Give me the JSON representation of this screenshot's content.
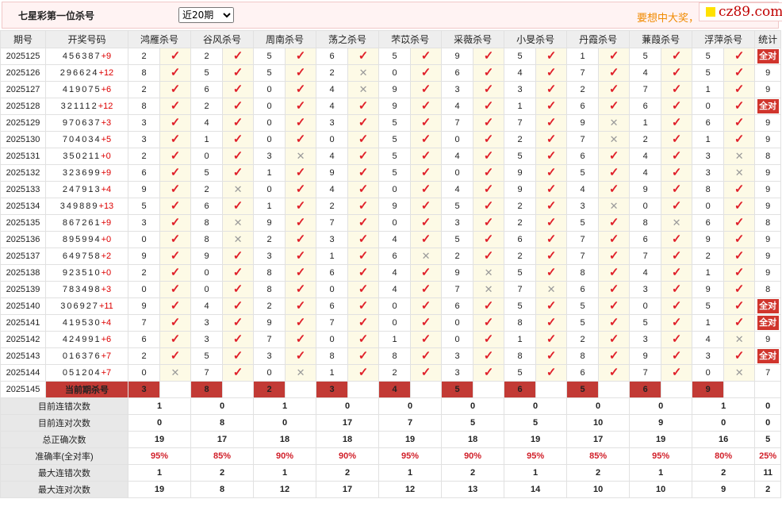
{
  "title": "七星彩第一位杀号",
  "period_select": {
    "selected": "近20期",
    "options": [
      "近20期"
    ]
  },
  "promo_text": "要想中大奖，",
  "logo_text": "cz89.com",
  "headers": {
    "issue": "期号",
    "draw": "开奖号码",
    "stat": "统计"
  },
  "experts": [
    "鸿雁杀号",
    "谷风杀号",
    "周南杀号",
    "荡之杀号",
    "芣苡杀号",
    "采薇杀号",
    "小旻杀号",
    "丹霞杀号",
    "蒹葭杀号",
    "浮萍杀号"
  ],
  "quan_label": "全对",
  "rows": [
    {
      "issue": "2025125",
      "nums": "456387",
      "sum": "+9",
      "kills": [
        "2",
        "2",
        "5",
        "6",
        "5",
        "9",
        "5",
        "1",
        "5",
        "5"
      ],
      "ok": [
        1,
        1,
        1,
        1,
        1,
        1,
        1,
        1,
        1,
        1
      ],
      "stat": "全对"
    },
    {
      "issue": "2025126",
      "nums": "296624",
      "sum": "+12",
      "kills": [
        "8",
        "5",
        "5",
        "2",
        "0",
        "6",
        "4",
        "7",
        "4",
        "5"
      ],
      "ok": [
        1,
        1,
        1,
        0,
        1,
        1,
        1,
        1,
        1,
        1
      ],
      "stat": "9"
    },
    {
      "issue": "2025127",
      "nums": "419075",
      "sum": "+6",
      "kills": [
        "2",
        "6",
        "0",
        "4",
        "9",
        "3",
        "3",
        "2",
        "7",
        "1"
      ],
      "ok": [
        1,
        1,
        1,
        0,
        1,
        1,
        1,
        1,
        1,
        1
      ],
      "stat": "9"
    },
    {
      "issue": "2025128",
      "nums": "321112",
      "sum": "+12",
      "kills": [
        "8",
        "2",
        "0",
        "4",
        "9",
        "4",
        "1",
        "6",
        "6",
        "0"
      ],
      "ok": [
        1,
        1,
        1,
        1,
        1,
        1,
        1,
        1,
        1,
        1
      ],
      "stat": "全对"
    },
    {
      "issue": "2025129",
      "nums": "970637",
      "sum": "+3",
      "kills": [
        "3",
        "4",
        "0",
        "3",
        "5",
        "7",
        "7",
        "9",
        "1",
        "6"
      ],
      "ok": [
        1,
        1,
        1,
        1,
        1,
        1,
        1,
        0,
        1,
        1
      ],
      "stat": "9"
    },
    {
      "issue": "2025130",
      "nums": "704034",
      "sum": "+5",
      "kills": [
        "3",
        "1",
        "0",
        "0",
        "5",
        "0",
        "2",
        "7",
        "2",
        "1"
      ],
      "ok": [
        1,
        1,
        1,
        1,
        1,
        1,
        1,
        0,
        1,
        1
      ],
      "stat": "9"
    },
    {
      "issue": "2025131",
      "nums": "350211",
      "sum": "+0",
      "kills": [
        "2",
        "0",
        "3",
        "4",
        "5",
        "4",
        "5",
        "6",
        "4",
        "3"
      ],
      "ok": [
        1,
        1,
        0,
        1,
        1,
        1,
        1,
        1,
        1,
        0
      ],
      "stat": "8"
    },
    {
      "issue": "2025132",
      "nums": "323699",
      "sum": "+9",
      "kills": [
        "6",
        "5",
        "1",
        "9",
        "5",
        "0",
        "9",
        "5",
        "4",
        "3"
      ],
      "ok": [
        1,
        1,
        1,
        1,
        1,
        1,
        1,
        1,
        1,
        0
      ],
      "stat": "9"
    },
    {
      "issue": "2025133",
      "nums": "247913",
      "sum": "+4",
      "kills": [
        "9",
        "2",
        "0",
        "4",
        "0",
        "4",
        "9",
        "4",
        "9",
        "8"
      ],
      "ok": [
        1,
        0,
        1,
        1,
        1,
        1,
        1,
        1,
        1,
        1
      ],
      "stat": "9"
    },
    {
      "issue": "2025134",
      "nums": "349889",
      "sum": "+13",
      "kills": [
        "5",
        "6",
        "1",
        "2",
        "9",
        "5",
        "2",
        "3",
        "0",
        "0"
      ],
      "ok": [
        1,
        1,
        1,
        1,
        1,
        1,
        1,
        0,
        1,
        1
      ],
      "stat": "9"
    },
    {
      "issue": "2025135",
      "nums": "867261",
      "sum": "+9",
      "kills": [
        "3",
        "8",
        "9",
        "7",
        "0",
        "3",
        "2",
        "5",
        "8",
        "6"
      ],
      "ok": [
        1,
        0,
        1,
        1,
        1,
        1,
        1,
        1,
        0,
        1
      ],
      "stat": "8"
    },
    {
      "issue": "2025136",
      "nums": "895994",
      "sum": "+0",
      "kills": [
        "0",
        "8",
        "2",
        "3",
        "4",
        "5",
        "6",
        "7",
        "6",
        "9"
      ],
      "ok": [
        1,
        0,
        1,
        1,
        1,
        1,
        1,
        1,
        1,
        1
      ],
      "stat": "9"
    },
    {
      "issue": "2025137",
      "nums": "649758",
      "sum": "+2",
      "kills": [
        "9",
        "9",
        "3",
        "1",
        "6",
        "2",
        "2",
        "7",
        "7",
        "2"
      ],
      "ok": [
        1,
        1,
        1,
        1,
        0,
        1,
        1,
        1,
        1,
        1
      ],
      "stat": "9"
    },
    {
      "issue": "2025138",
      "nums": "923510",
      "sum": "+0",
      "kills": [
        "2",
        "0",
        "8",
        "6",
        "4",
        "9",
        "5",
        "8",
        "4",
        "1"
      ],
      "ok": [
        1,
        1,
        1,
        1,
        1,
        0,
        1,
        1,
        1,
        1
      ],
      "stat": "9"
    },
    {
      "issue": "2025139",
      "nums": "783498",
      "sum": "+3",
      "kills": [
        "0",
        "0",
        "8",
        "0",
        "4",
        "7",
        "7",
        "6",
        "3",
        "9"
      ],
      "ok": [
        1,
        1,
        1,
        1,
        1,
        0,
        0,
        1,
        1,
        1
      ],
      "stat": "8"
    },
    {
      "issue": "2025140",
      "nums": "306927",
      "sum": "+11",
      "kills": [
        "9",
        "4",
        "2",
        "6",
        "0",
        "6",
        "5",
        "5",
        "0",
        "5"
      ],
      "ok": [
        1,
        1,
        1,
        1,
        1,
        1,
        1,
        1,
        1,
        1
      ],
      "stat": "全对"
    },
    {
      "issue": "2025141",
      "nums": "419530",
      "sum": "+4",
      "kills": [
        "7",
        "3",
        "9",
        "7",
        "0",
        "0",
        "8",
        "5",
        "5",
        "1"
      ],
      "ok": [
        1,
        1,
        1,
        1,
        1,
        1,
        1,
        1,
        1,
        1
      ],
      "stat": "全对"
    },
    {
      "issue": "2025142",
      "nums": "424991",
      "sum": "+6",
      "kills": [
        "6",
        "3",
        "7",
        "0",
        "1",
        "0",
        "1",
        "2",
        "3",
        "4"
      ],
      "ok": [
        1,
        1,
        1,
        1,
        1,
        1,
        1,
        1,
        1,
        0
      ],
      "stat": "9"
    },
    {
      "issue": "2025143",
      "nums": "016376",
      "sum": "+7",
      "kills": [
        "2",
        "5",
        "3",
        "8",
        "8",
        "3",
        "8",
        "8",
        "9",
        "3"
      ],
      "ok": [
        1,
        1,
        1,
        1,
        1,
        1,
        1,
        1,
        1,
        1
      ],
      "stat": "全对"
    },
    {
      "issue": "2025144",
      "nums": "051204",
      "sum": "+7",
      "kills": [
        "0",
        "7",
        "0",
        "1",
        "2",
        "3",
        "5",
        "6",
        "7",
        "0"
      ],
      "ok": [
        0,
        1,
        0,
        1,
        1,
        1,
        1,
        1,
        1,
        0
      ],
      "stat": "7"
    }
  ],
  "current": {
    "issue": "2025145",
    "label": "当前期杀号",
    "kills": [
      "3",
      "8",
      "2",
      "3",
      "4",
      "5",
      "6",
      "5",
      "6",
      "9"
    ]
  },
  "stats": [
    {
      "label": "目前连错次数",
      "values": [
        "1",
        "0",
        "1",
        "0",
        "0",
        "0",
        "0",
        "0",
        "0",
        "1",
        "0"
      ],
      "red": false
    },
    {
      "label": "目前连对次数",
      "values": [
        "0",
        "8",
        "0",
        "17",
        "7",
        "5",
        "5",
        "10",
        "9",
        "0",
        "0"
      ],
      "red": false
    },
    {
      "label": "总正确次数",
      "values": [
        "19",
        "17",
        "18",
        "18",
        "19",
        "18",
        "19",
        "17",
        "19",
        "16",
        "5"
      ],
      "red": false
    },
    {
      "label": "准确率(全对率)",
      "values": [
        "95%",
        "85%",
        "90%",
        "90%",
        "95%",
        "90%",
        "95%",
        "85%",
        "95%",
        "80%",
        "25%"
      ],
      "red": true
    },
    {
      "label": "最大连错次数",
      "values": [
        "1",
        "2",
        "1",
        "2",
        "1",
        "2",
        "1",
        "2",
        "1",
        "2",
        "11"
      ],
      "red": false
    },
    {
      "label": "最大连对次数",
      "values": [
        "19",
        "8",
        "12",
        "17",
        "12",
        "13",
        "14",
        "10",
        "10",
        "9",
        "2"
      ],
      "red": false
    }
  ],
  "colors": {
    "tick": "#e0202a",
    "cross": "#9a9a9a",
    "quan_bg": "#d0352d",
    "stat_blue": "#1f3fcf",
    "stat_red": "#d1202a"
  }
}
